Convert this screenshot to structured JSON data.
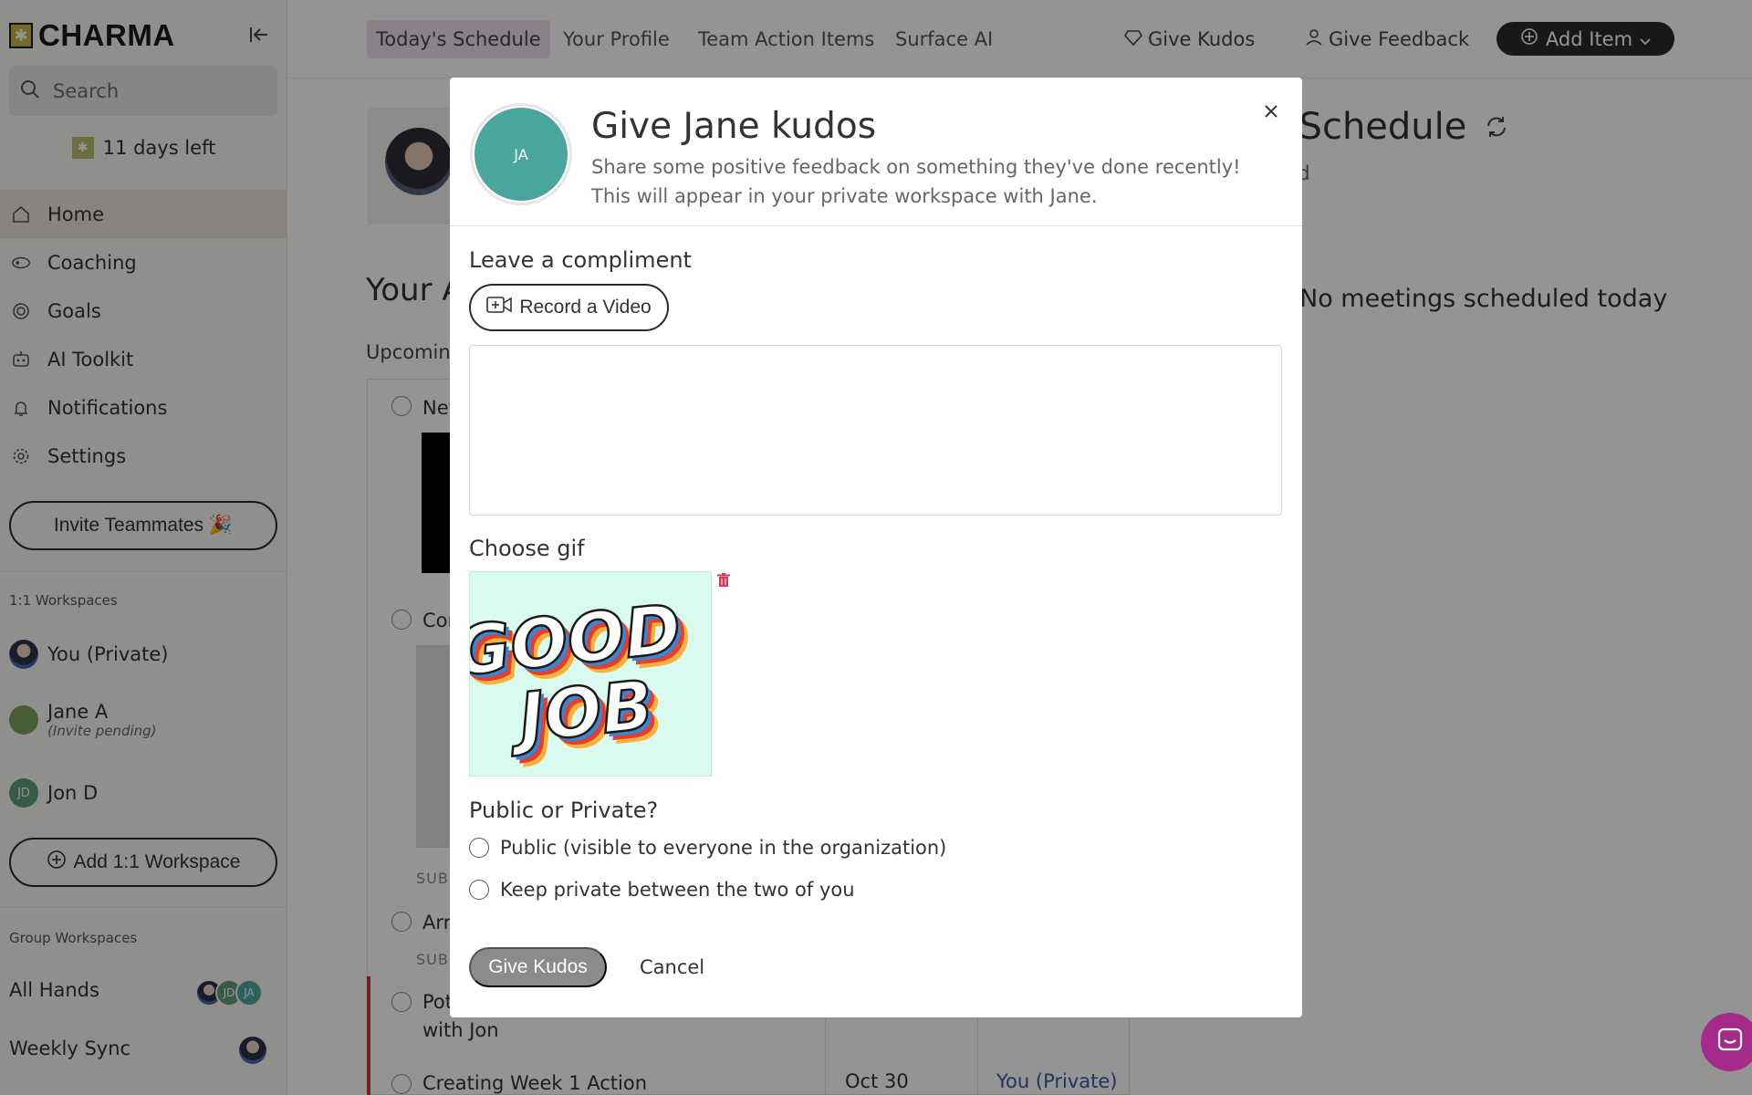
{
  "brand": {
    "name": "CHARMA"
  },
  "sidebar": {
    "search_placeholder": "Search",
    "trial": "11 days left",
    "nav": [
      {
        "label": "Home",
        "icon": "home-icon",
        "active": true
      },
      {
        "label": "Coaching",
        "icon": "coaching-icon"
      },
      {
        "label": "Goals",
        "icon": "goals-icon"
      },
      {
        "label": "AI Toolkit",
        "icon": "robot-icon"
      },
      {
        "label": "Notifications",
        "icon": "bell-icon"
      },
      {
        "label": "Settings",
        "icon": "gear-icon"
      }
    ],
    "invite_label": "Invite Teammates 🎉",
    "one_on_one_label": "1:1 Workspaces",
    "workspaces": [
      {
        "name": "You (Private)"
      },
      {
        "name": "Jane A",
        "note": "(Invite pending)"
      },
      {
        "name": "Jon D",
        "initials": "JD"
      }
    ],
    "add_workspace_label": "Add 1:1 Workspace",
    "group_label": "Group Workspaces",
    "groups": [
      {
        "name": "All Hands",
        "initials": [
          "JD",
          "JA"
        ]
      },
      {
        "name": "Weekly Sync"
      }
    ]
  },
  "topbar": {
    "tabs": [
      "Today's Schedule",
      "Your Profile",
      "Team Action Items",
      "Surface AI"
    ],
    "give_kudos": "Give Kudos",
    "give_feedback": "Give Feedback",
    "add_item": "Add Item"
  },
  "background": {
    "heading_fragment": "Your A",
    "upcoming_fragment": "Upcoming",
    "row1_fragment": "Nev",
    "row2_fragment": "Cor",
    "row3_fragment": "Arr",
    "row4_fragment": "Pot",
    "row4_line2": "with Jon",
    "row5": "Creating Week 1 Action",
    "row5_date": "Oct 30",
    "row5_owner": "You (Private)",
    "sub_label": "SUB",
    "schedule_title_fragment": "s Schedule",
    "schedule_sub_fragment": "rd",
    "no_meetings": "No meetings scheduled today"
  },
  "modal": {
    "avatar_initials": "JA",
    "title": "Give Jane kudos",
    "description": "Share some positive feedback on something they've done recently! This will appear in your private workspace with Jane.",
    "compliment_label": "Leave a compliment",
    "record_label": "Record a Video",
    "compliment_value": "",
    "gif_label": "Choose gif",
    "gif_text": [
      "GOOD",
      "JOB"
    ],
    "visibility_label": "Public or Private?",
    "options": [
      "Public (visible to everyone in the organization)",
      "Keep private between the two of you"
    ],
    "submit_label": "Give Kudos",
    "cancel_label": "Cancel"
  },
  "colors": {
    "accent_avatar": "#4aa59d",
    "active_tab_bg": "#ece1ec",
    "chat_fab": "#a52a8a",
    "delete": "#d63a5a"
  }
}
